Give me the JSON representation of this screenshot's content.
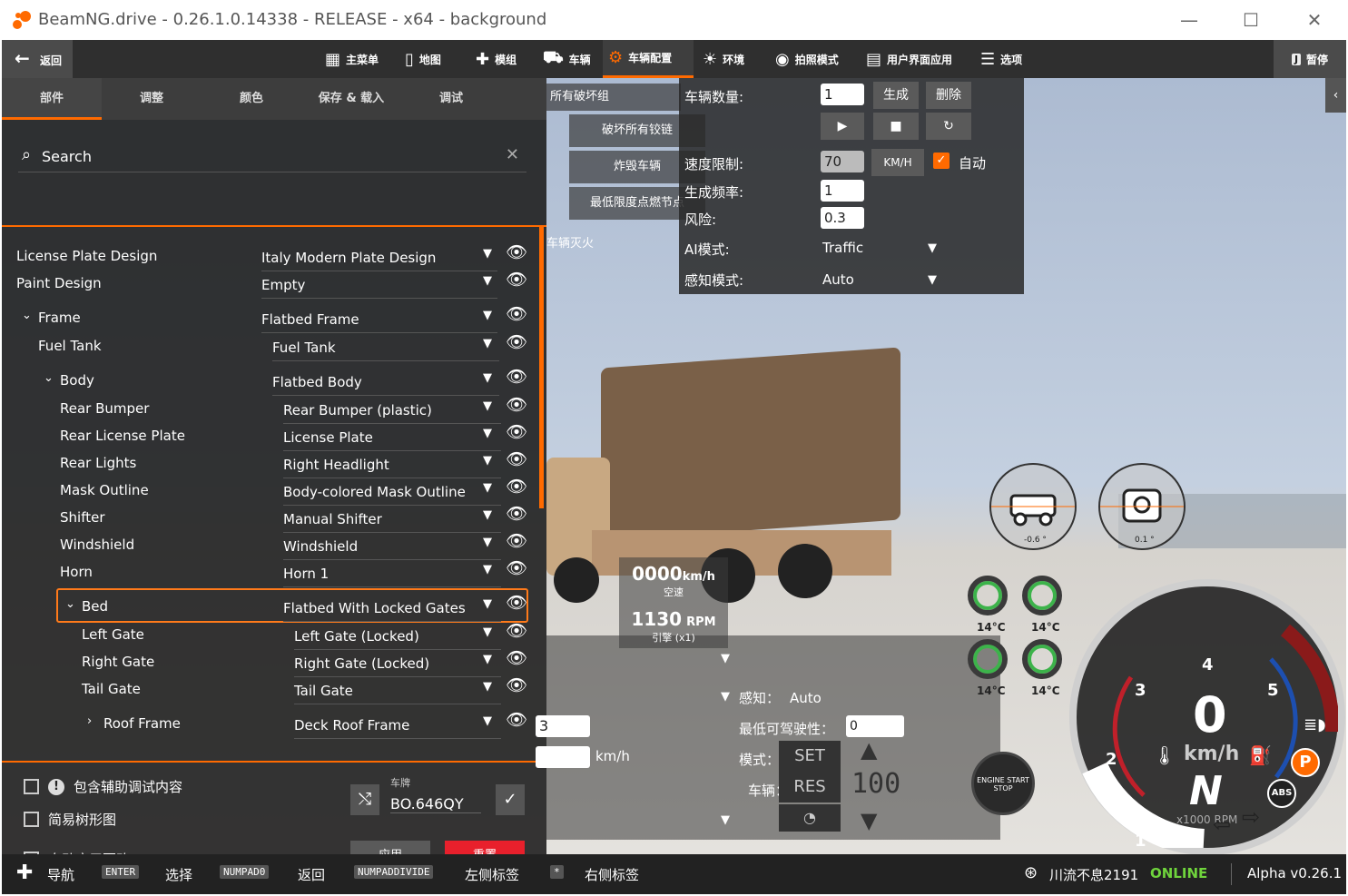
{
  "window": {
    "title": "BeamNG.drive - 0.26.1.0.14338 - RELEASE - x64 - background",
    "minimize": "—",
    "maximize": "☐",
    "close": "✕"
  },
  "topbar": {
    "back_label": "返回",
    "nav": [
      {
        "label": "主菜单",
        "icon": "menu-icon"
      },
      {
        "label": "地图",
        "icon": "map-icon"
      },
      {
        "label": "模组",
        "icon": "puzzle-icon"
      },
      {
        "label": "车辆",
        "icon": "car-icon"
      },
      {
        "label": "车辆配置",
        "icon": "engine-icon",
        "active": true
      },
      {
        "label": "环境",
        "icon": "weather-icon"
      },
      {
        "label": "拍照模式",
        "icon": "camera-icon"
      },
      {
        "label": "用户界面应用",
        "icon": "apps-icon"
      },
      {
        "label": "选项",
        "icon": "sliders-icon"
      }
    ],
    "pause_label": "暂停",
    "pause_key": "J"
  },
  "tabs": [
    "部件",
    "调整",
    "颜色",
    "保存 & 载入",
    "调试"
  ],
  "search": {
    "placeholder": "Search"
  },
  "parts": [
    {
      "name": "License Plate Design",
      "value": "Italy Modern Plate Design"
    },
    {
      "name": "Paint Design",
      "value": "Empty"
    },
    {
      "name": "Frame",
      "value": "Flatbed Frame"
    },
    {
      "name": "Fuel Tank",
      "value": "Fuel Tank"
    },
    {
      "name": "Body",
      "value": "Flatbed Body"
    },
    {
      "name": "Rear Bumper",
      "value": "Rear Bumper (plastic)"
    },
    {
      "name": "Rear License Plate",
      "value": "License Plate"
    },
    {
      "name": "Rear Lights",
      "value": "Right Headlight"
    },
    {
      "name": "Mask Outline",
      "value": "Body-colored Mask Outline"
    },
    {
      "name": "Shifter",
      "value": "Manual Shifter"
    },
    {
      "name": "Windshield",
      "value": "Windshield"
    },
    {
      "name": "Horn",
      "value": "Horn 1"
    },
    {
      "name": "Bed",
      "value": "Flatbed With Locked Gates"
    },
    {
      "name": "Left Gate",
      "value": "Left Gate (Locked)"
    },
    {
      "name": "Right Gate",
      "value": "Right Gate (Locked)"
    },
    {
      "name": "Tail Gate",
      "value": "Tail Gate"
    },
    {
      "name": "Roof Frame",
      "value": "Deck Roof Frame"
    }
  ],
  "options": {
    "debug_content": "包含辅助调试内容",
    "simple_tree": "简易树形图",
    "auto_apply": "自动应用更改"
  },
  "plate": {
    "label": "车牌",
    "value": "BO.646QY"
  },
  "buttons": {
    "apply": "应用",
    "reset": "重置"
  },
  "debug_menu": [
    "所有破坏组",
    "破坏所有铰链",
    "炸毁车辆",
    "最低限度点燃节点",
    "车辆灭火"
  ],
  "traffic": {
    "count_label": "车辆数量:",
    "count_value": "1",
    "spawn": "生成",
    "delete": "删除",
    "speed_label": "速度限制:",
    "speed_value": "70",
    "speed_unit": "KM/H",
    "auto_label": "自动",
    "freq_label": "生成频率:",
    "freq_value": "1",
    "risk_label": "风险:",
    "risk_value": "0.3",
    "ai_mode_label": "AI模式:",
    "ai_mode_value": "Traffic",
    "sense_label": "感知模式:",
    "sense_value": "Auto"
  },
  "hud": {
    "speed": "0000",
    "speed_unit": "km/h",
    "gear_state": "空速",
    "rpm": "1130",
    "rpm_unit": "RPM",
    "engine_label": "引擎 (x1)",
    "pitch_value": "-0.6 °",
    "roll_value": "0.1 °",
    "tire_temps": [
      "14°C",
      "14°C",
      "14°C",
      "14°C"
    ],
    "speedo_value": "0",
    "speedo_unit": "km/h",
    "gear": "N",
    "rpm_scale": "x1000 RPM",
    "rpm_ticks": [
      "1",
      "2",
      "3",
      "4",
      "5"
    ],
    "engine_btn": "ENGINE START STOP"
  },
  "ai_panel": {
    "sense_label": "感知：",
    "sense_value": "Auto",
    "min_drive_label": "最低可驾驶性：",
    "min_drive_value": "0",
    "mode_label": "模式：",
    "set": "SET",
    "vehicle_label": "车辆：",
    "res": "RES",
    "speed_display": "100",
    "speed_input": "3",
    "kmh": "km/h"
  },
  "bottombar": {
    "nav": "导航",
    "enter_key": "ENTER",
    "select": "选择",
    "numpad0_key": "NUMPAD0",
    "back": "返回",
    "numdiv_key": "NUMPADDIVIDE",
    "left_tag": "左侧标签",
    "star_key": "*",
    "right_tag": "右侧标签",
    "user": "川流不息2191",
    "status": "ONLINE",
    "version": "Alpha v0.26.1"
  },
  "colors": {
    "accent": "#ff6a00",
    "reset": "#e8202c",
    "online": "#6fd43c"
  }
}
